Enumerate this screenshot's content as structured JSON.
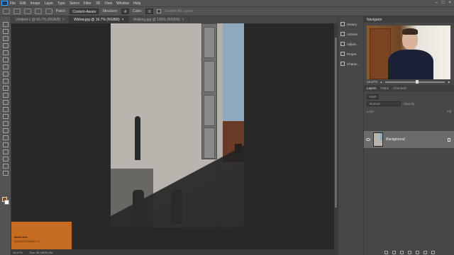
{
  "menubar": {
    "items": [
      "File",
      "Edit",
      "Image",
      "Layer",
      "Type",
      "Select",
      "Filter",
      "3D",
      "View",
      "Window",
      "Help"
    ]
  },
  "options": {
    "patch_label": "Patch:",
    "patch_value": "Content-Aware",
    "structure_label": "Structure:",
    "structure_value": "4",
    "color_label": "Color:",
    "color_value": "0",
    "sample_label": "Sample All Layers"
  },
  "tabs": [
    {
      "label": "Untitled-1 @ 66.7% (RGB/8)",
      "active": false
    },
    {
      "label": "Widow.jpg @ 16.7% (RGB/8)",
      "active": true
    },
    {
      "label": "Walking.jpg @ 100% (RGB/8)",
      "active": false
    }
  ],
  "status": {
    "zoom": "16.67%",
    "doc": "Doc: 96.1M/96.1M"
  },
  "swatch": {
    "name": "NutriLock",
    "hex": "#C56B22 E6B66A0 C8"
  },
  "icon_column": [
    "History",
    "Actions",
    "Adjust...",
    "Proper...",
    "Charac..."
  ],
  "navigator": {
    "title": "Navigator",
    "zoom": "16.67%"
  },
  "layers": {
    "tabs": [
      "Layers",
      "Paths",
      "Channels"
    ],
    "kind": "Kind",
    "mode": "Normal",
    "opacity_label": "Opacity:",
    "fill_label": "Fill:",
    "lock_label": "Lock:",
    "layer_name": "Background"
  },
  "colors": {
    "accent_swatch": "#C56B22",
    "panel_bg": "#474747",
    "workspace_bg": "#282828"
  }
}
